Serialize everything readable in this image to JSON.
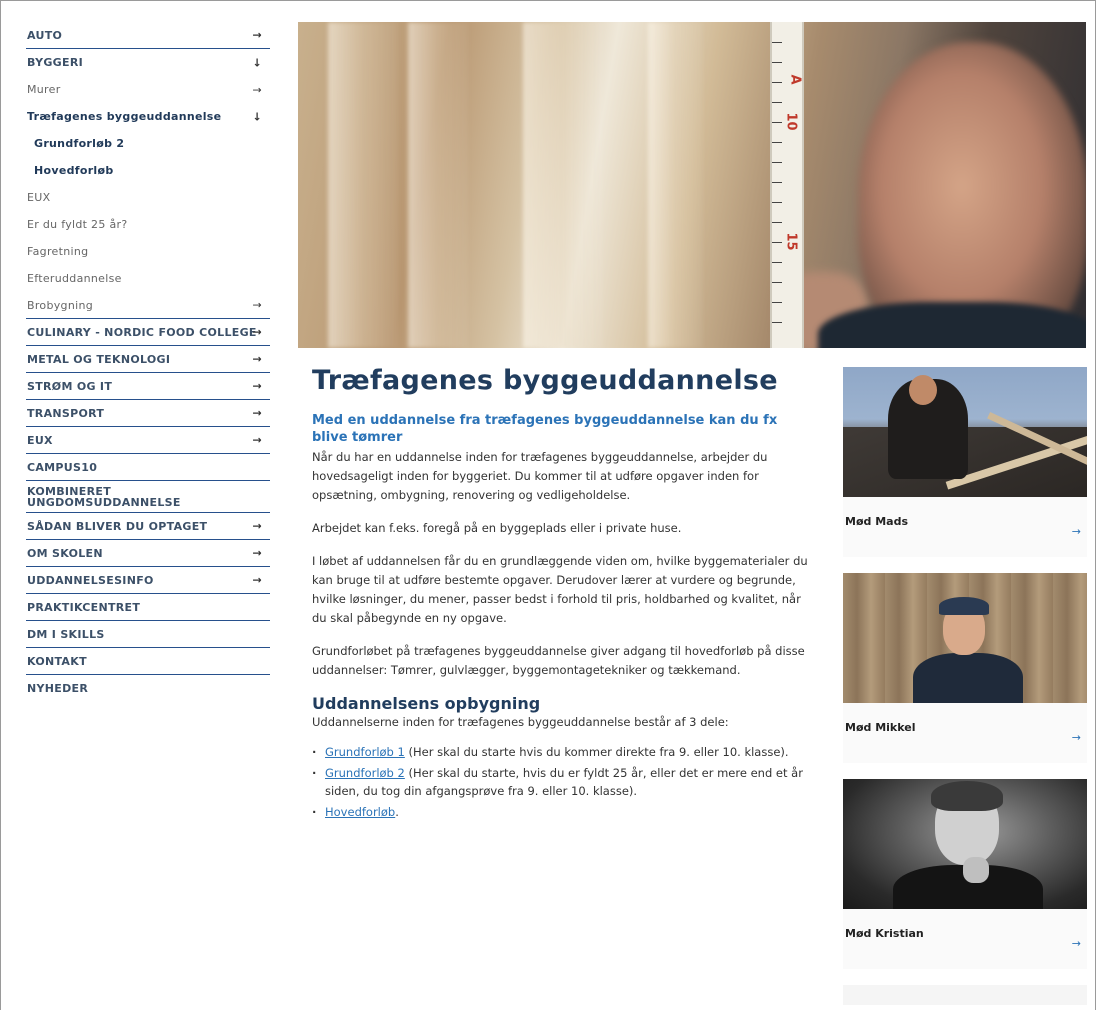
{
  "sidebar": {
    "items": [
      {
        "label": "AUTO",
        "arrow": "→"
      },
      {
        "label": "BYGGERI",
        "arrow": "↓"
      },
      {
        "label": "Murer",
        "arrow": "→"
      },
      {
        "label": "Træfagenes byggeuddannelse",
        "arrow": "↓"
      },
      {
        "label": "Grundforløb 2"
      },
      {
        "label": "Hovedforløb"
      },
      {
        "label": "EUX"
      },
      {
        "label": "Er du fyldt 25 år?"
      },
      {
        "label": "Fagretning"
      },
      {
        "label": "Efteruddannelse"
      },
      {
        "label": "Brobygning",
        "arrow": "→"
      },
      {
        "label": "CULINARY - NORDIC FOOD COLLEGE",
        "arrow": "→"
      },
      {
        "label": "METAL OG TEKNOLOGI",
        "arrow": "→"
      },
      {
        "label": "STRØM OG IT",
        "arrow": "→"
      },
      {
        "label": "TRANSPORT",
        "arrow": "→"
      },
      {
        "label": "EUX",
        "arrow": "→"
      },
      {
        "label": "CAMPUS10"
      },
      {
        "label": "KOMBINERET UNGDOMSUDDANNELSE"
      },
      {
        "label": "SÅDAN BLIVER DU OPTAGET",
        "arrow": "→"
      },
      {
        "label": "OM SKOLEN",
        "arrow": "→"
      },
      {
        "label": "UDDANNELSESINFO",
        "arrow": "→"
      },
      {
        "label": "PRAKTIKCENTRET"
      },
      {
        "label": "DM I SKILLS"
      },
      {
        "label": "KONTAKT"
      },
      {
        "label": "NYHEDER"
      }
    ]
  },
  "hero": {
    "ruler_numbers": [
      "A",
      "10",
      "15"
    ]
  },
  "main": {
    "title": "Træfagenes byggeuddannelse",
    "lead": "Med en uddannelse fra træfagenes byggeuddannelse kan du fx blive tømrer",
    "paragraphs": [
      "Når du har en uddannelse inden for træfagenes byggeuddannelse, arbejder du hovedsageligt inden for byggeriet. Du kommer til at udføre opgaver inden for opsætning, ombygning, renovering og vedligeholdelse.",
      "Arbejdet kan f.eks. foregå på en byggeplads eller i private huse.",
      "I løbet af uddannelsen får du en grundlæggende viden om, hvilke byggematerialer du kan bruge til at udføre bestemte opgaver. Derudover lærer at vurdere og begrunde, hvilke løsninger, du mener, passer bedst i forhold til pris, holdbarhed og kvalitet, når du skal påbegynde en ny opgave.",
      "Grundforløbet på træfagenes byggeuddannelse giver adgang til hovedforløb på disse uddannelser: Tømrer, gulvlægger, byggemontagetekniker og tækkemand."
    ],
    "section_title": "Uddannelsens opbygning",
    "section_intro": "Uddannelserne inden for træfagenes byggeuddannelse består af 3 dele:",
    "list": [
      {
        "link": "Grundforløb 1",
        "text": " (Her skal du starte hvis du kommer direkte fra 9. eller 10. klasse)."
      },
      {
        "link": "Grundforløb 2",
        "text": " (Her skal du starte, hvis du er fyldt 25 år, eller det er mere end et år siden, du tog din afgangsprøve fra 9. eller 10. klasse)."
      },
      {
        "link": "Hovedforløb",
        "text": "."
      }
    ]
  },
  "cards": [
    {
      "name": "Mød Mads",
      "arrow": "→"
    },
    {
      "name": "Mød Mikkel",
      "arrow": "→"
    },
    {
      "name": "Mød Kristian",
      "arrow": "→"
    }
  ]
}
